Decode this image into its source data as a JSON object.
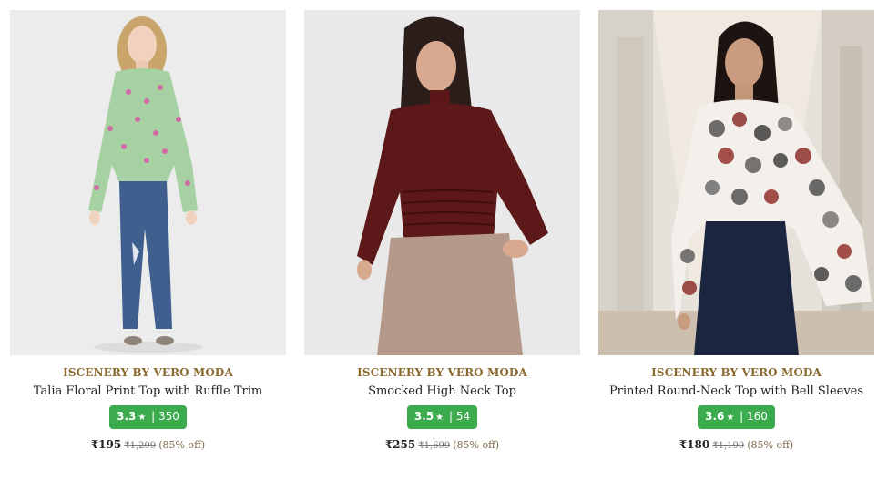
{
  "products": [
    {
      "brand": "ISCENERY BY VERO MODA",
      "title": "Talia Floral Print Top with Ruffle Trim",
      "rating": "3.3",
      "reviews": "350",
      "price": "₹195",
      "mrp": "₹1,299",
      "discount": "(85% off)",
      "image": "woman-in-floral-top-and-jeans"
    },
    {
      "brand": "ISCENERY BY VERO MODA",
      "title": "Smocked High Neck Top",
      "rating": "3.5",
      "reviews": "54",
      "price": "₹255",
      "mrp": "₹1,699",
      "discount": "(85% off)",
      "image": "woman-in-maroon-smocked-top"
    },
    {
      "brand": "ISCENERY BY VERO MODA",
      "title": "Printed Round-Neck Top with Bell Sleeves",
      "rating": "3.6",
      "reviews": "160",
      "price": "₹180",
      "mrp": "₹1,199",
      "discount": "(85% off)",
      "image": "woman-in-printed-bell-sleeve-top"
    }
  ],
  "colors": {
    "rating_badge": "#3bab4e",
    "brand_text": "#8b6a2f"
  }
}
